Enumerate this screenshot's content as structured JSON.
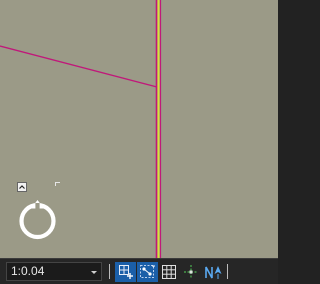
{
  "map": {
    "background_color": "#9b9a87",
    "features": [
      "magenta-road-line",
      "yellow-road-line",
      "magenta-diagonal-line"
    ],
    "colors": {
      "magenta": "#c0187a",
      "yellow": "#d8e23c"
    }
  },
  "navigator": {
    "collapse_icon": "chevron-up-icon",
    "ring_icon": "navigator-ring-icon"
  },
  "statusbar": {
    "scale_value": "1:0.04",
    "tools": [
      {
        "name": "zoom-extent-tool",
        "icon": "extent-plus-icon",
        "active": true
      },
      {
        "name": "snapping-tool",
        "icon": "snapping-icon",
        "active": true
      },
      {
        "name": "grid-tool",
        "icon": "grid-icon",
        "active": false
      },
      {
        "name": "cursor-coordinates-tool",
        "icon": "crosshair-icon",
        "active": false
      },
      {
        "name": "north-arrow-tool",
        "icon": "north-arrow-icon",
        "active": false
      }
    ],
    "accent": "#1b5fa8"
  }
}
